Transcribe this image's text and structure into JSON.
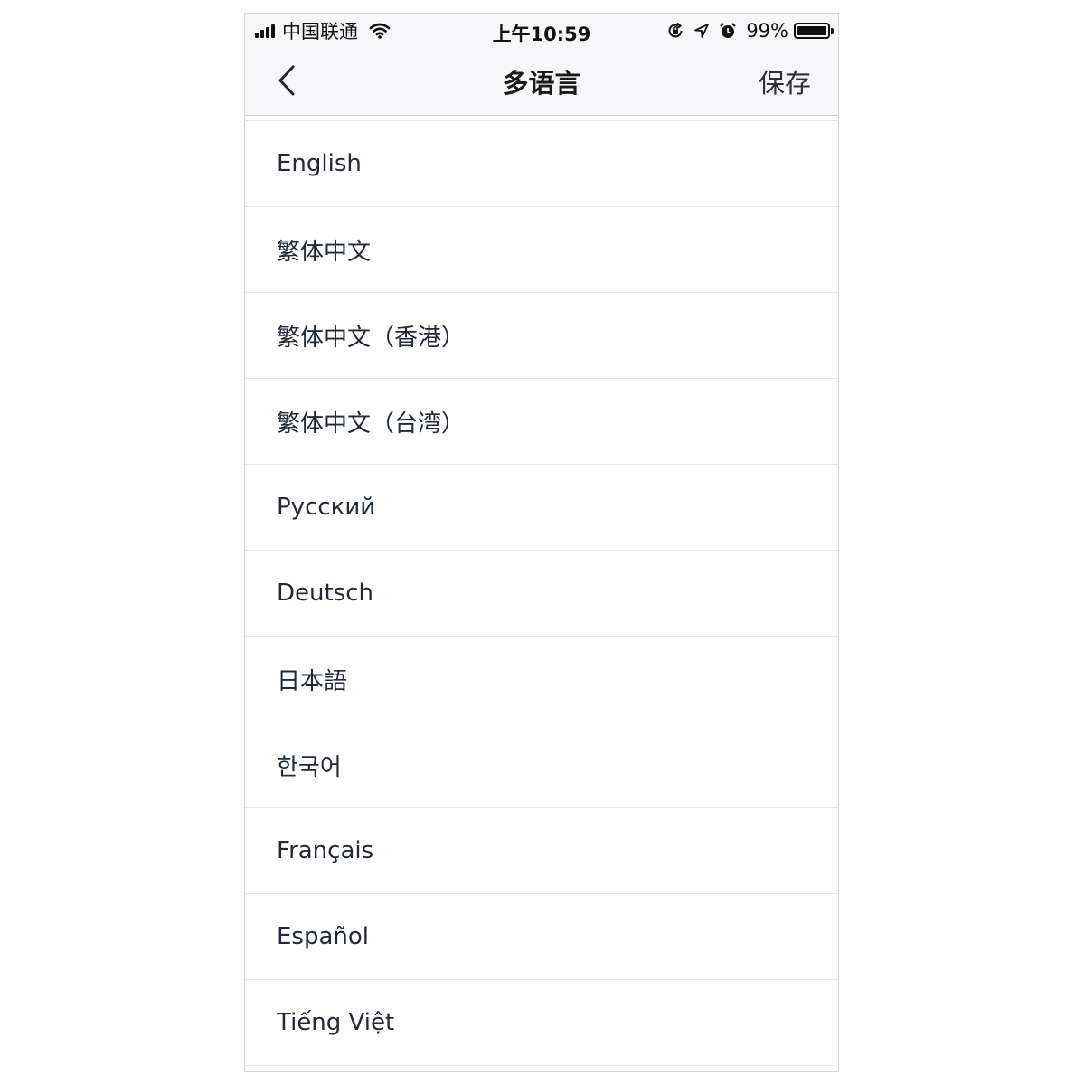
{
  "status_bar": {
    "carrier": "中国联通",
    "time": "上午10:59",
    "battery": "99%",
    "battery_level": 0.99,
    "icons": [
      "signal-icon",
      "wifi-icon",
      "orientation-lock-icon",
      "location-arrow-icon",
      "alarm-icon",
      "battery-icon"
    ]
  },
  "nav": {
    "back_icon": "chevron-left-icon",
    "title": "多语言",
    "save_label": "保存"
  },
  "languages": [
    {
      "label": "English"
    },
    {
      "label": "繁体中文"
    },
    {
      "label": "繁体中文（香港）"
    },
    {
      "label": "繁体中文（台湾）"
    },
    {
      "label": "Русский"
    },
    {
      "label": "Deutsch"
    },
    {
      "label": "日本語"
    },
    {
      "label": "한국어"
    },
    {
      "label": "Français"
    },
    {
      "label": "Español"
    },
    {
      "label": "Tiếng Việt"
    }
  ],
  "colors": {
    "navbar_bg": "#f7f7f9",
    "text": "#1f2a36"
  }
}
